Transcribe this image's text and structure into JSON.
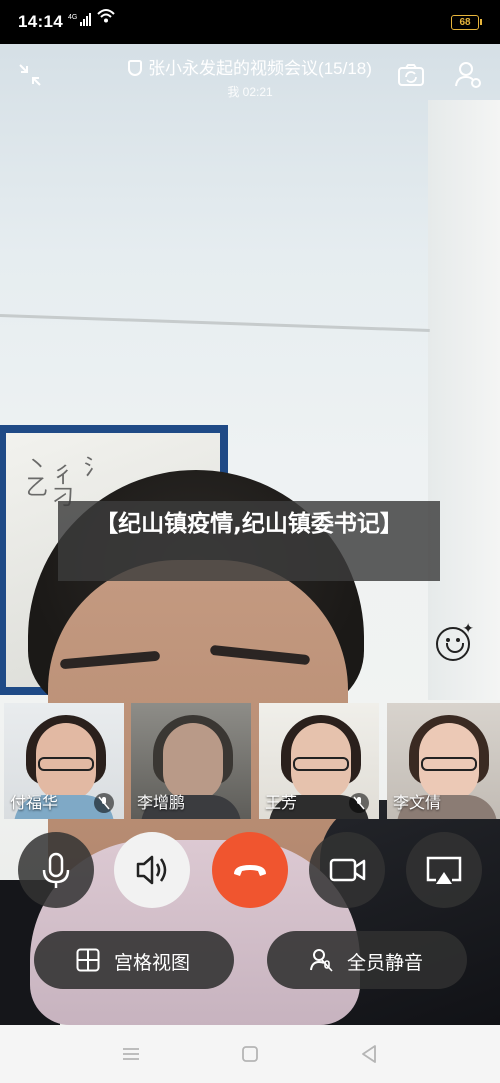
{
  "status_bar": {
    "time": "14:14",
    "network": "4G",
    "battery": "68"
  },
  "meeting": {
    "title": "张小永发起的视频会议(15/18)",
    "subtitle": "我 02:21"
  },
  "caption": "【纪山镇疫情,纪山镇委书记】",
  "participants": [
    {
      "name": "付福华",
      "muted": true
    },
    {
      "name": "李增鹏",
      "muted": false
    },
    {
      "name": "王芳",
      "muted": true
    },
    {
      "name": "李文倩",
      "muted": false
    }
  ],
  "controls": {
    "grid_view_label": "宫格视图",
    "mute_all_label": "全员静音"
  },
  "colors": {
    "hangup": "#f0552f",
    "battery": "#e7b53c"
  },
  "icons": [
    "minimize-icon",
    "camera-switch-icon",
    "members-icon",
    "emoji-icon",
    "microphone-icon",
    "speaker-icon",
    "hangup-icon",
    "video-camera-icon",
    "screen-share-icon",
    "grid-icon",
    "mute-all-icon",
    "menu-icon",
    "home-icon",
    "back-icon"
  ]
}
